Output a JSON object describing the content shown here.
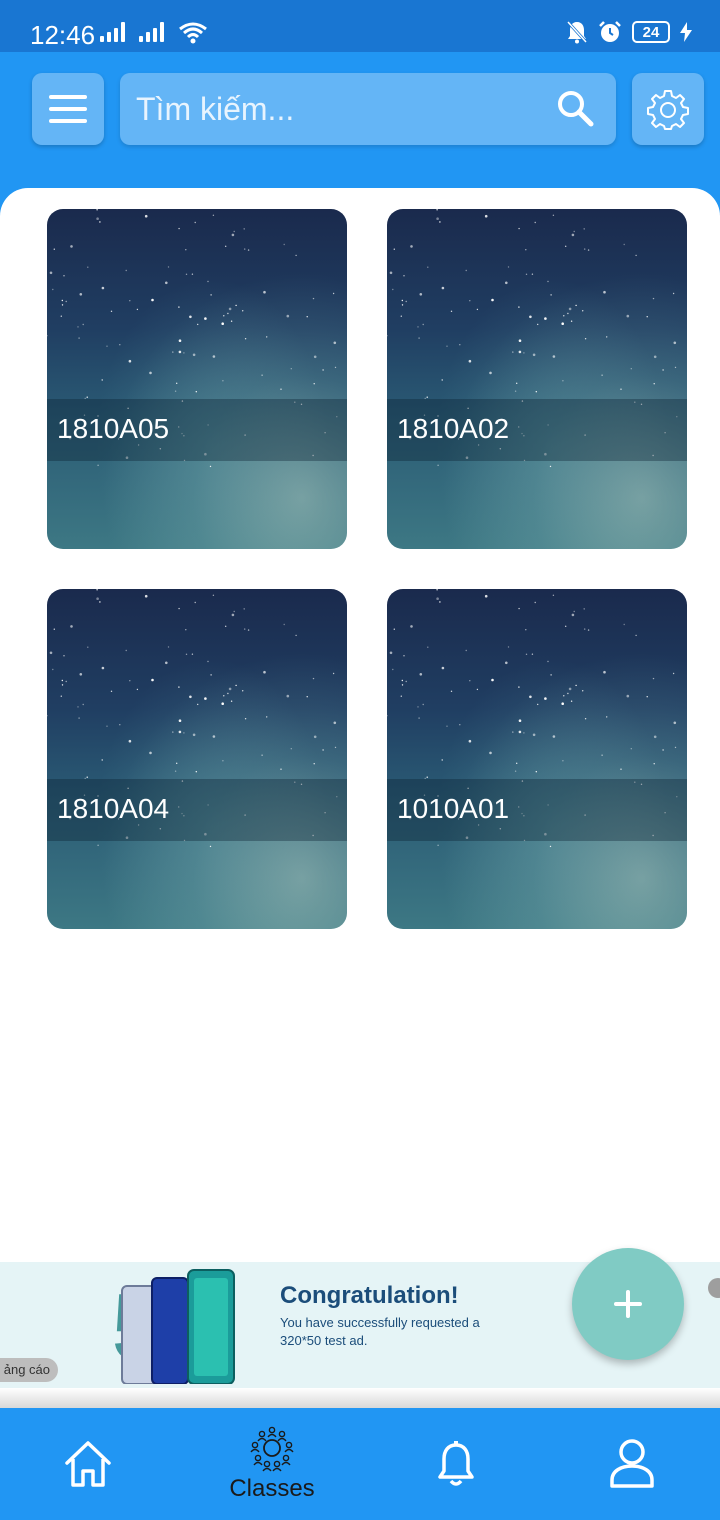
{
  "status_bar": {
    "time": "12:46",
    "battery": "24",
    "icons": [
      "signal-icon",
      "signal-icon",
      "wifi-icon",
      "bell-off-icon",
      "alarm-icon",
      "battery-icon",
      "charging-icon"
    ]
  },
  "app_bar": {
    "menu_icon": "hamburger-menu-icon",
    "search_placeholder": "Tìm kiếm...",
    "search_icon": "search-icon",
    "settings_icon": "gear-icon",
    "color": "#2196F3"
  },
  "classes": [
    {
      "name": "1810A05"
    },
    {
      "name": "1810A02"
    },
    {
      "name": "1810A04"
    },
    {
      "name": "1010A01"
    }
  ],
  "ad": {
    "tag": "ảng cáo",
    "title": "Congratulation!",
    "subtitle": "You have successfully requested a 320*50 test ad.",
    "big_text": "5G"
  },
  "fab": {
    "icon": "plus-icon",
    "color": "#80CBC4"
  },
  "bottom_nav": {
    "items": [
      {
        "icon": "home-icon",
        "label": ""
      },
      {
        "icon": "classes-group-icon",
        "label": "Classes"
      },
      {
        "icon": "bell-icon",
        "label": ""
      },
      {
        "icon": "user-icon",
        "label": ""
      }
    ],
    "active": "Classes"
  }
}
